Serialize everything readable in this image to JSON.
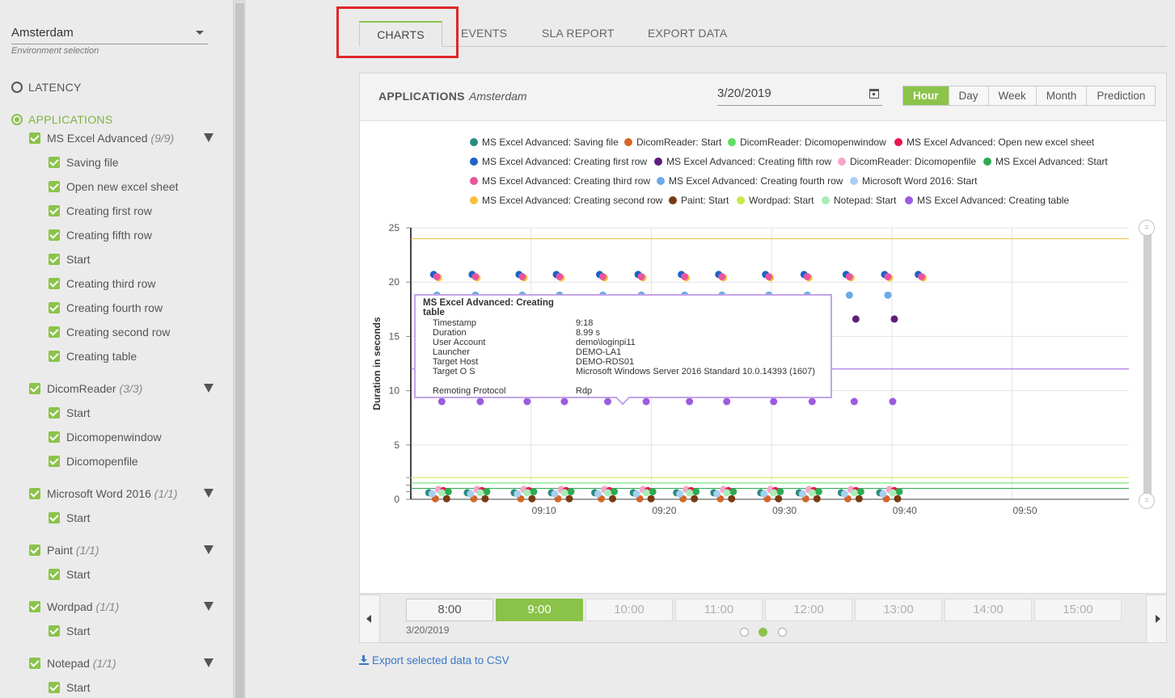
{
  "sidebar": {
    "environment": {
      "value": "Amsterdam",
      "hint": "Environment selection"
    },
    "latency_label": "LATENCY",
    "applications_label": "APPLICATIONS",
    "groups": [
      {
        "name": "MS Excel Advanced",
        "count": "(9/9)",
        "items": [
          "Saving file",
          "Open new excel sheet",
          "Creating first row",
          "Creating fifth row",
          "Start",
          "Creating third row",
          "Creating fourth row",
          "Creating second row",
          "Creating table"
        ]
      },
      {
        "name": "DicomReader",
        "count": "(3/3)",
        "items": [
          "Start",
          "Dicomopenwindow",
          "Dicomopenfile"
        ]
      },
      {
        "name": "Microsoft Word 2016",
        "count": "(1/1)",
        "items": [
          "Start"
        ]
      },
      {
        "name": "Paint",
        "count": "(1/1)",
        "items": [
          "Start"
        ]
      },
      {
        "name": "Wordpad",
        "count": "(1/1)",
        "items": [
          "Start"
        ]
      },
      {
        "name": "Notepad",
        "count": "(1/1)",
        "items": [
          "Start"
        ]
      }
    ]
  },
  "tabs": [
    "CHARTS",
    "EVENTS",
    "SLA REPORT",
    "EXPORT DATA"
  ],
  "panel": {
    "title": "APPLICATIONS",
    "subtitle": "Amsterdam",
    "date": "3/20/2019",
    "ranges": [
      "Hour",
      "Day",
      "Week",
      "Month",
      "Prediction"
    ],
    "selected_range": "Hour"
  },
  "colors": {
    "accent": "#8bc34a",
    "highlight_box": "#e0262a",
    "link": "#3a78c9"
  },
  "chart_data": {
    "type": "scatter",
    "ylabel": "Duration in seconds",
    "ylim": [
      0,
      25
    ],
    "yticks": [
      "0",
      "5",
      "10",
      "15",
      "20",
      "25"
    ],
    "xticks": [
      "09:10",
      "09:20",
      "09:30",
      "09:40",
      "09:50"
    ],
    "x_minutes": [
      1.5,
      4.7,
      8.6,
      11.7,
      15.3,
      18.5,
      22.1,
      25.2,
      29.1,
      32.3,
      35.8,
      39.0,
      41.8
    ],
    "legend": [
      {
        "name": "MS Excel Advanced: Saving file",
        "color": "#2a8c7e"
      },
      {
        "name": "DicomReader: Start",
        "color": "#d4652a"
      },
      {
        "name": "DicomReader: Dicomopenwindow",
        "color": "#5ce05c"
      },
      {
        "name": "MS Excel Advanced: Open new excel sheet",
        "color": "#e8174c"
      },
      {
        "name": "MS Excel Advanced: Creating first row",
        "color": "#1e62c8"
      },
      {
        "name": "MS Excel Advanced: Creating fifth row",
        "color": "#5e1e78"
      },
      {
        "name": "DicomReader: Dicomopenfile",
        "color": "#f4a6cc"
      },
      {
        "name": "MS Excel Advanced: Start",
        "color": "#2eaa52"
      },
      {
        "name": "MS Excel Advanced: Creating third row",
        "color": "#e8559e"
      },
      {
        "name": "MS Excel Advanced: Creating fourth row",
        "color": "#6aaae8"
      },
      {
        "name": "Microsoft Word 2016: Start",
        "color": "#a8cff0"
      },
      {
        "name": "MS Excel Advanced: Creating second row",
        "color": "#f7c23a"
      },
      {
        "name": "Paint: Start",
        "color": "#7a3a12"
      },
      {
        "name": "Wordpad: Start",
        "color": "#c6ea4a"
      },
      {
        "name": "Notepad: Start",
        "color": "#a8ecb8"
      },
      {
        "name": "MS Excel Advanced: Creating table",
        "color": "#9a5ce0"
      }
    ],
    "series_values": {
      "first_row": 20.7,
      "second_row": 20.4,
      "third_row": 20.5,
      "fourth_row": 18.8,
      "fifth_row": 16.6,
      "table": 9.0,
      "others_low": [
        0.7,
        0.9,
        0.4,
        0.6,
        1.0
      ]
    },
    "reference_lines": [
      {
        "value": 24.0,
        "color": "#f0c040"
      },
      {
        "value": 12.0,
        "color": "#9a5ce0"
      },
      {
        "value": 2.0,
        "color": "#c6ea4a"
      },
      {
        "value": 1.5,
        "color": "#5ce05c"
      },
      {
        "value": 1.0,
        "color": "#2eaa52"
      }
    ]
  },
  "tooltip": {
    "title": "MS Excel Advanced: Creating table",
    "rows": [
      {
        "k": "Timestamp",
        "v": "9:18"
      },
      {
        "k": "Duration",
        "v": "8.99 s"
      },
      {
        "k": "User Account",
        "v": "demo\\loginpi11"
      },
      {
        "k": "Launcher",
        "v": "DEMO-LA1"
      },
      {
        "k": "Target Host",
        "v": "DEMO-RDS01"
      },
      {
        "k": "Target O S",
        "v": "Microsoft Windows Server 2016 Standard 10.0.14393 (1607)"
      },
      {
        "k": "Remoting Protocol",
        "v": "Rdp"
      }
    ]
  },
  "timeline": {
    "hours": [
      "8:00",
      "9:00",
      "10:00",
      "11:00",
      "12:00",
      "13:00",
      "14:00",
      "15:00"
    ],
    "selected": "9:00",
    "date": "3/20/2019",
    "pages": 3,
    "current_page": 2
  },
  "export_label": "Export selected data to CSV"
}
